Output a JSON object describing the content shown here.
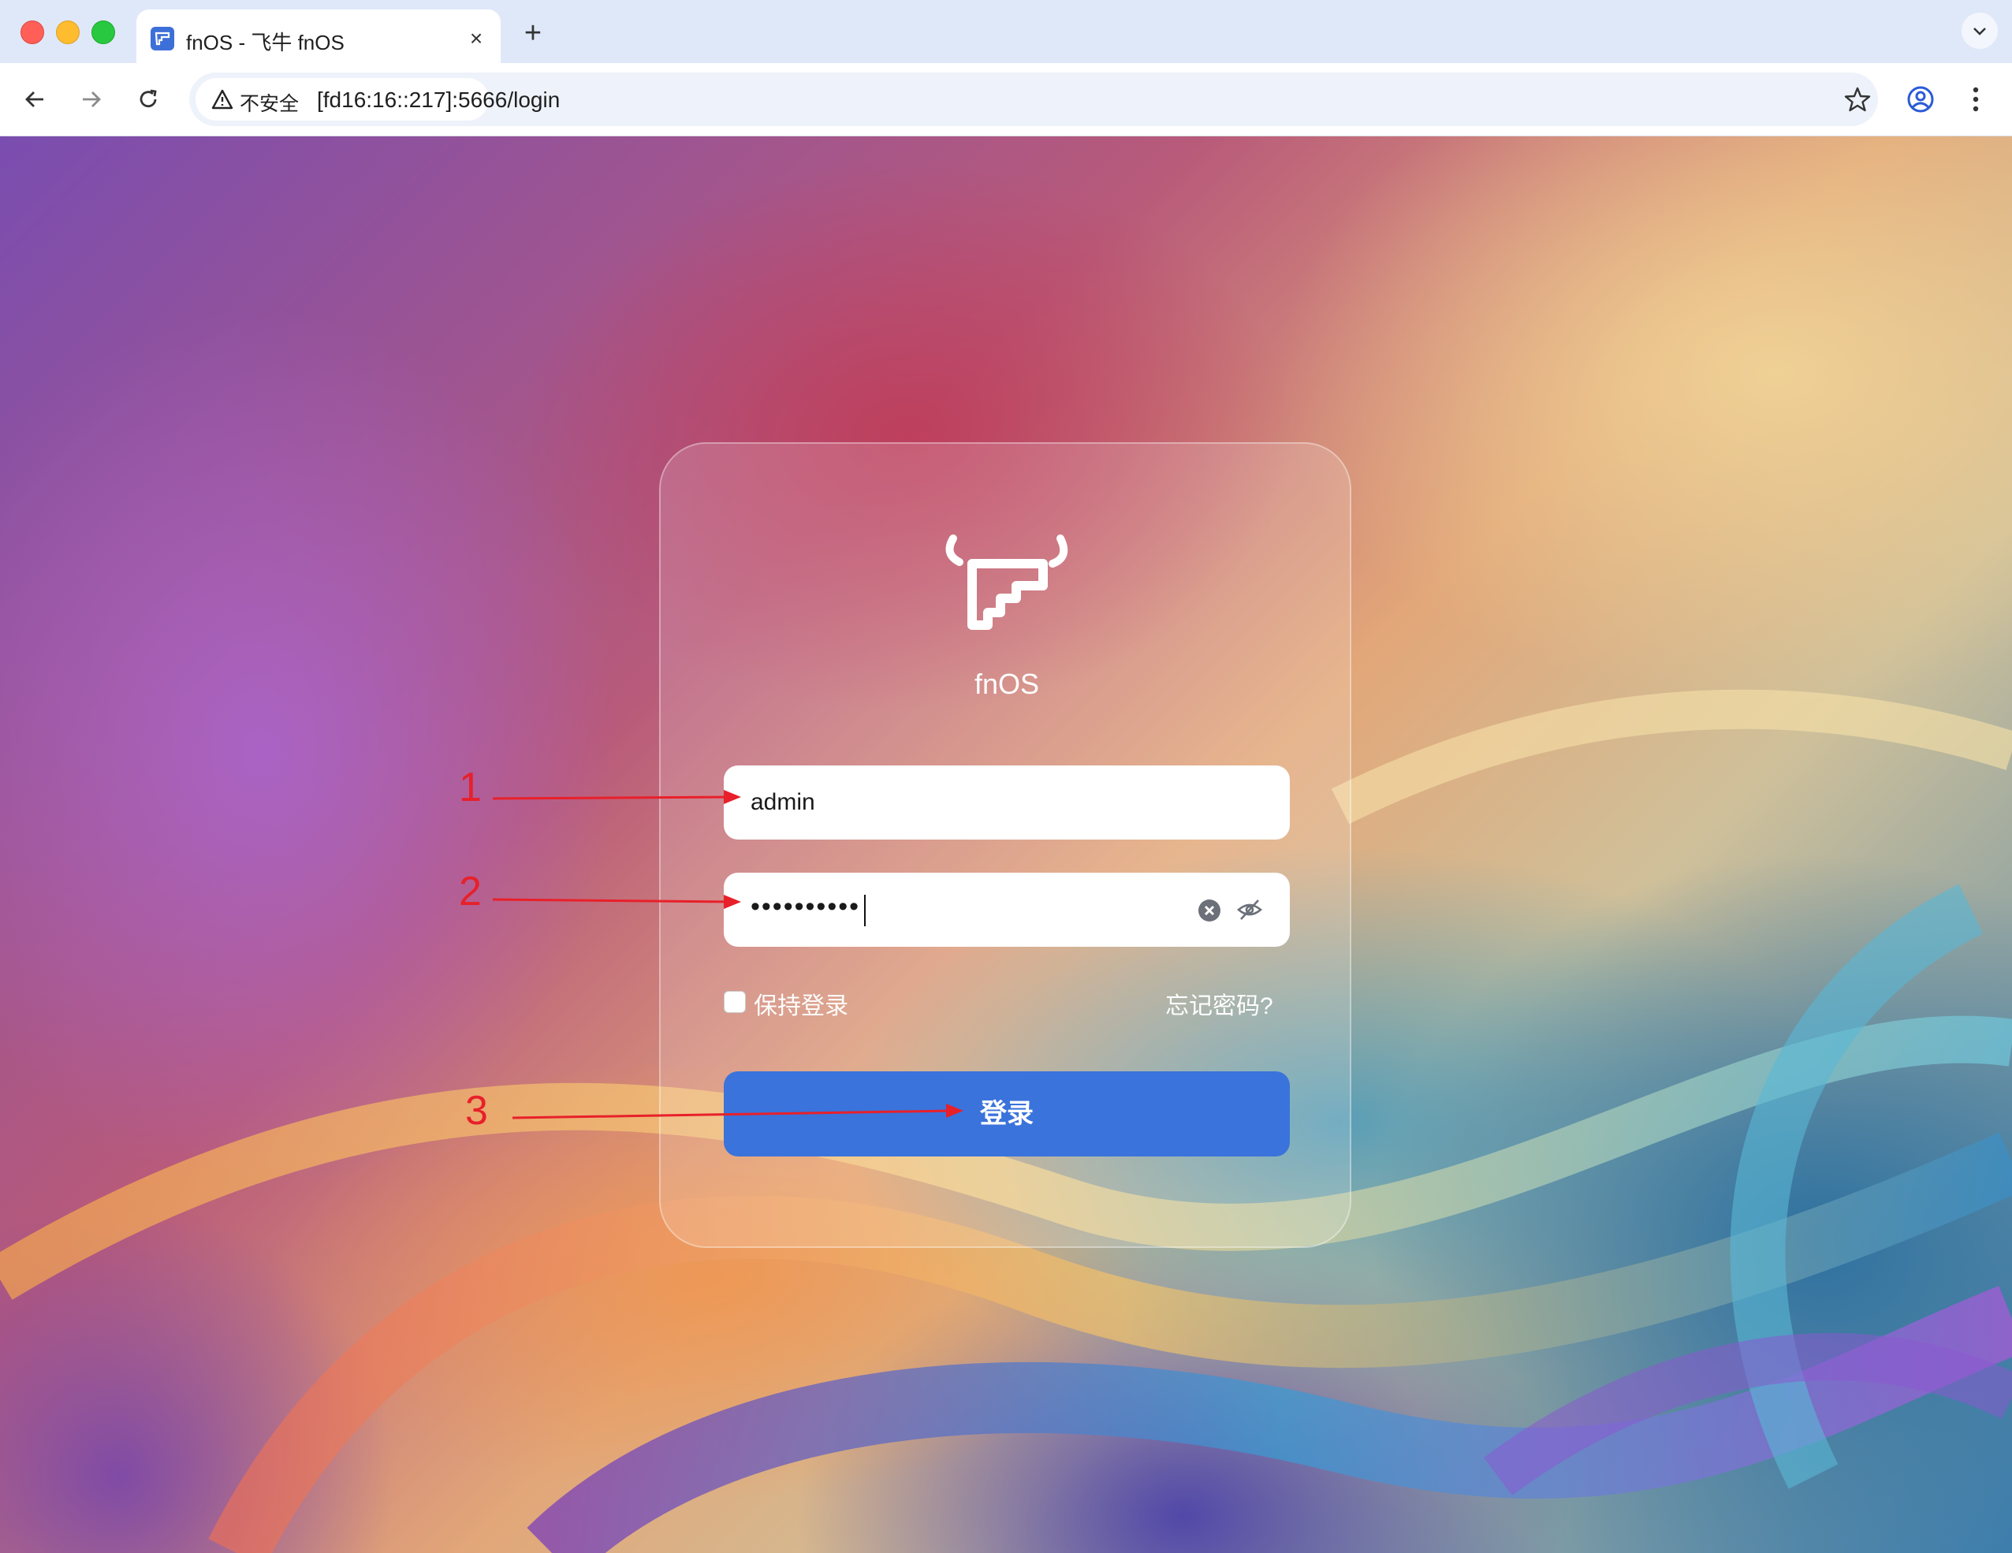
{
  "browser": {
    "tab": {
      "title": "fnOS - 飞牛 fnOS",
      "close": "×"
    },
    "new_tab": "+",
    "address_bar": {
      "security_label": "不安全",
      "url": "[fd16:16::217]:5666/login"
    },
    "icons": [
      "back-icon",
      "forward-icon",
      "reload-icon",
      "warning-icon",
      "star-icon",
      "profile-icon",
      "menu-icon",
      "chevron-down-icon"
    ]
  },
  "login": {
    "brand_name": "fnOS",
    "username": {
      "value": "admin"
    },
    "password": {
      "value": "••••••••••"
    },
    "remember_label": "保持登录",
    "remember_checked": false,
    "forgot_label": "忘记密码?",
    "submit_label": "登录",
    "accent_color": "#3a73db"
  },
  "annotations": [
    {
      "label": "1"
    },
    {
      "label": "2"
    },
    {
      "label": "3"
    }
  ],
  "colors": {
    "annotation": "#e8202a",
    "tabbar": "#dfe8f9"
  }
}
